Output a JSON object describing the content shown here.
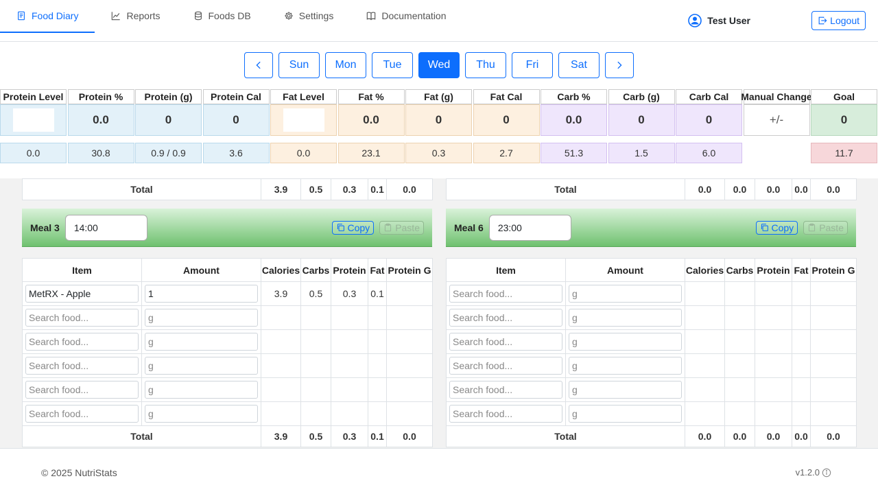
{
  "nav": {
    "tabs": [
      {
        "label": "Food Diary",
        "icon": "journal-icon",
        "active": true
      },
      {
        "label": "Reports",
        "icon": "chart-line-icon",
        "active": false
      },
      {
        "label": "Foods DB",
        "icon": "database-icon",
        "active": false
      },
      {
        "label": "Settings",
        "icon": "gear-icon",
        "active": false
      },
      {
        "label": "Documentation",
        "icon": "book-icon",
        "active": false
      }
    ],
    "user_name": "Test User",
    "logout_label": "Logout"
  },
  "days": [
    "Sun",
    "Mon",
    "Tue",
    "Wed",
    "Thu",
    "Fri",
    "Sat"
  ],
  "active_day": "Wed",
  "stats": [
    {
      "label": "Protein Level",
      "value": "",
      "sub": "0.0",
      "color": "blue"
    },
    {
      "label": "Protein %",
      "value": "0.0",
      "sub": "30.8",
      "color": "blue"
    },
    {
      "label": "Protein (g)",
      "value": "0",
      "sub": "0.9 / 0.9",
      "color": "blue"
    },
    {
      "label": "Protein Cal",
      "value": "0",
      "sub": "3.6",
      "color": "blue"
    },
    {
      "label": "Fat Level",
      "value": "",
      "sub": "0.0",
      "color": "orange"
    },
    {
      "label": "Fat %",
      "value": "0.0",
      "sub": "23.1",
      "color": "orange"
    },
    {
      "label": "Fat (g)",
      "value": "0",
      "sub": "0.3",
      "color": "orange"
    },
    {
      "label": "Fat Cal",
      "value": "0",
      "sub": "2.7",
      "color": "orange"
    },
    {
      "label": "Carb %",
      "value": "0.0",
      "sub": "51.3",
      "color": "purple"
    },
    {
      "label": "Carb (g)",
      "value": "0",
      "sub": "1.5",
      "color": "purple"
    },
    {
      "label": "Carb Cal",
      "value": "0",
      "sub": "6.0",
      "color": "purple"
    },
    {
      "label": "Manual Change",
      "value": "+/-",
      "sub": "",
      "color": "white"
    },
    {
      "label": "Goal",
      "value": "0",
      "sub": "11.7",
      "color": "green"
    }
  ],
  "table_headers": [
    "Item",
    "Amount",
    "Calories",
    "Carbs",
    "Protein",
    "Fat",
    "Protein G"
  ],
  "total_label": "Total",
  "search_placeholder": "Search food...",
  "amount_placeholder": "g",
  "copy_label": "Copy",
  "paste_label": "Paste",
  "left": {
    "top_total": [
      "3.9",
      "0.5",
      "0.3",
      "0.1",
      "0.0"
    ],
    "meal_label": "Meal 3",
    "time": "14:00",
    "first_item": {
      "name": "MetRX - Apple",
      "amount": "1",
      "calories": "3.9",
      "carbs": "0.5",
      "protein": "0.3",
      "fat": "0.1",
      "protein_g": ""
    },
    "total": [
      "3.9",
      "0.5",
      "0.3",
      "0.1",
      "0.0"
    ]
  },
  "right": {
    "top_total": [
      "0.0",
      "0.0",
      "0.0",
      "0.0",
      "0.0"
    ],
    "meal_label": "Meal 6",
    "time": "23:00",
    "total": [
      "0.0",
      "0.0",
      "0.0",
      "0.0",
      "0.0"
    ]
  },
  "footer": {
    "copyright": "© 2025 NutriStats",
    "version": "v1.2.0"
  }
}
